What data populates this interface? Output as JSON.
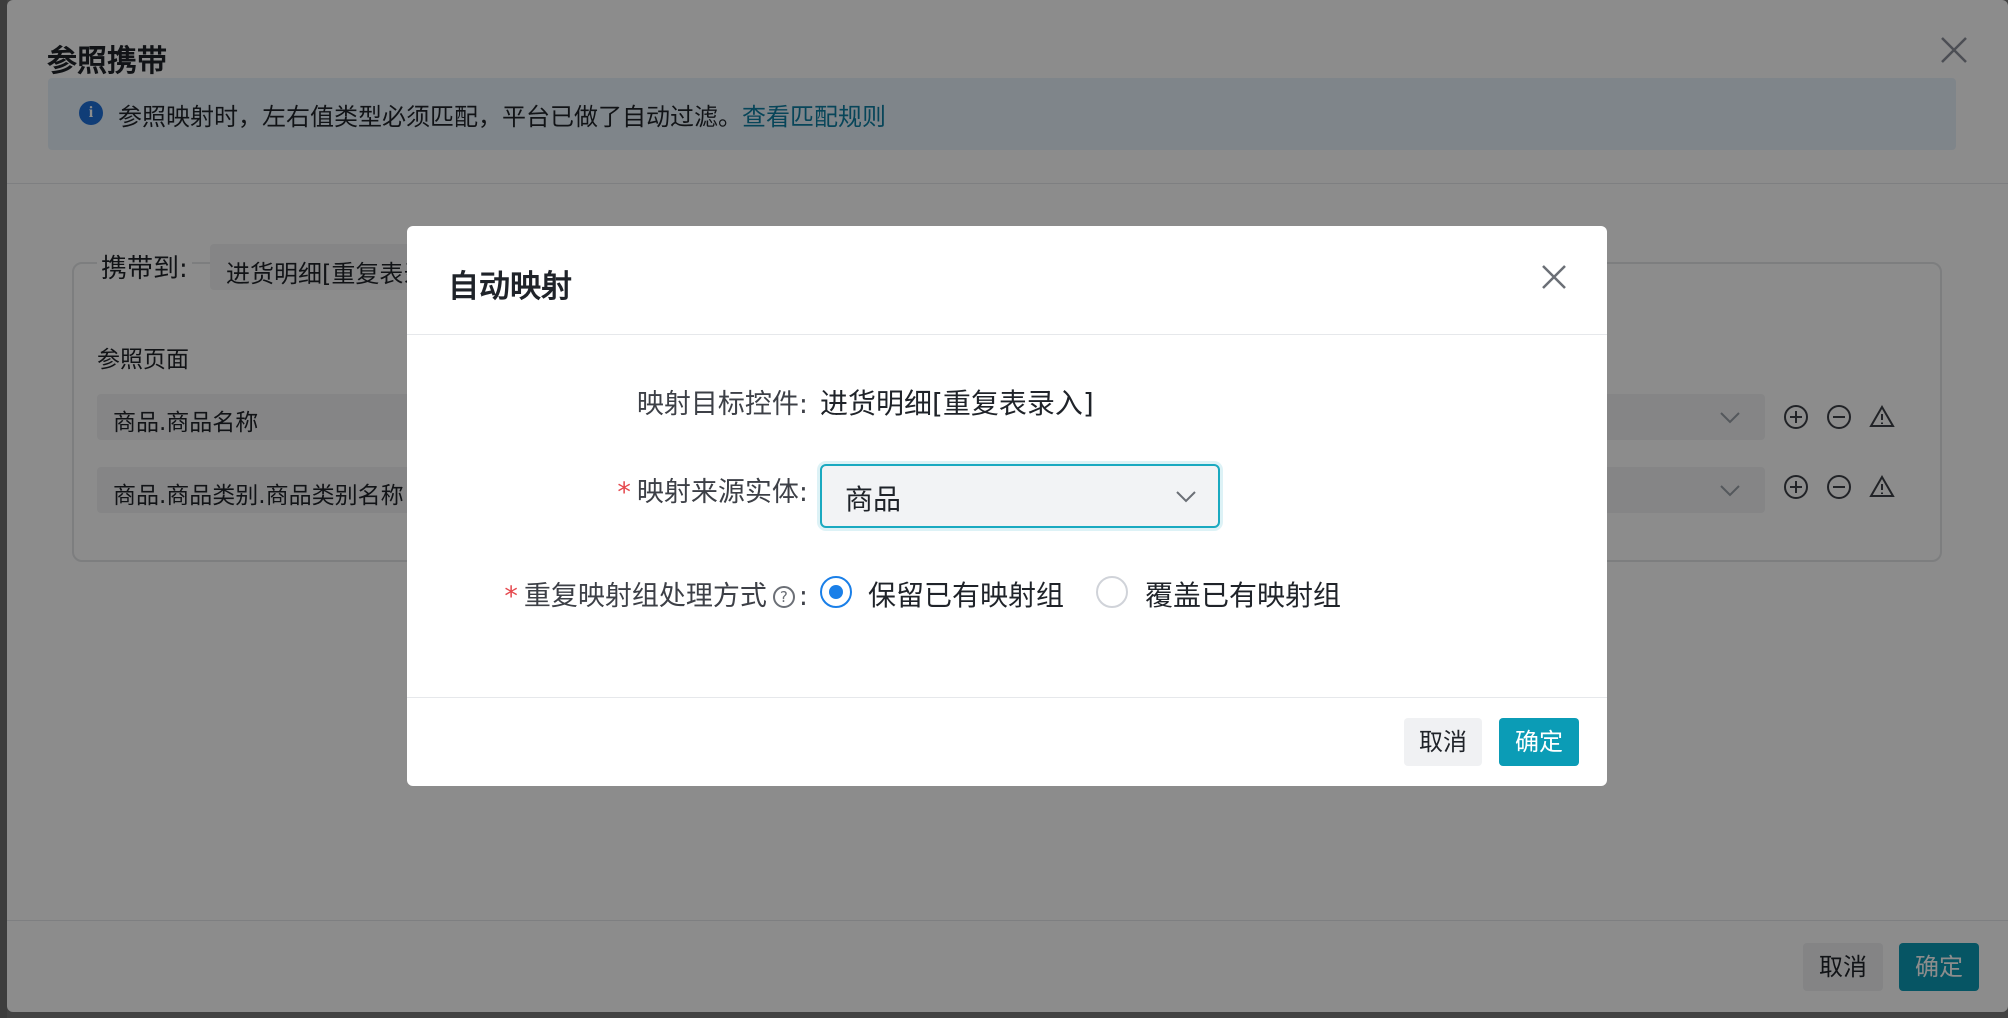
{
  "background_dialog": {
    "title": "参照携带",
    "alert": {
      "text": "参照映射时，左右值类型必须匹配，平台已做了自动过滤。",
      "link": "查看匹配规则",
      "icon": "info-icon"
    },
    "carry_to_label": "携带到:",
    "carry_to_value": "进货明细[重复表录",
    "ref_page_label": "参照页面",
    "rows": [
      {
        "value": "商品.商品名称"
      },
      {
        "value": "商品.商品类别.商品类别名称"
      }
    ],
    "row_icons": [
      "plus-circle-icon",
      "minus-circle-icon",
      "warning-triangle-icon"
    ],
    "cancel_label": "取消",
    "ok_label": "确定"
  },
  "modal": {
    "title": "自动映射",
    "target_label": "映射目标控件:",
    "target_value": "进货明细[重复表录入]",
    "source_required_mark": "*",
    "source_label": "映射来源实体:",
    "source_value": "商品",
    "dup_required_mark": "*",
    "dup_label": "重复映射组处理方式",
    "dup_help": "?",
    "dup_colon": ":",
    "options": [
      {
        "label": "保留已有映射组",
        "checked": true
      },
      {
        "label": "覆盖已有映射组",
        "checked": false
      }
    ],
    "cancel_label": "取消",
    "ok_label": "确定"
  },
  "colors": {
    "primary": "#0b9cb6",
    "radio_checked": "#1a7fe8",
    "required": "#e5484d",
    "link": "#0e7fa3"
  }
}
